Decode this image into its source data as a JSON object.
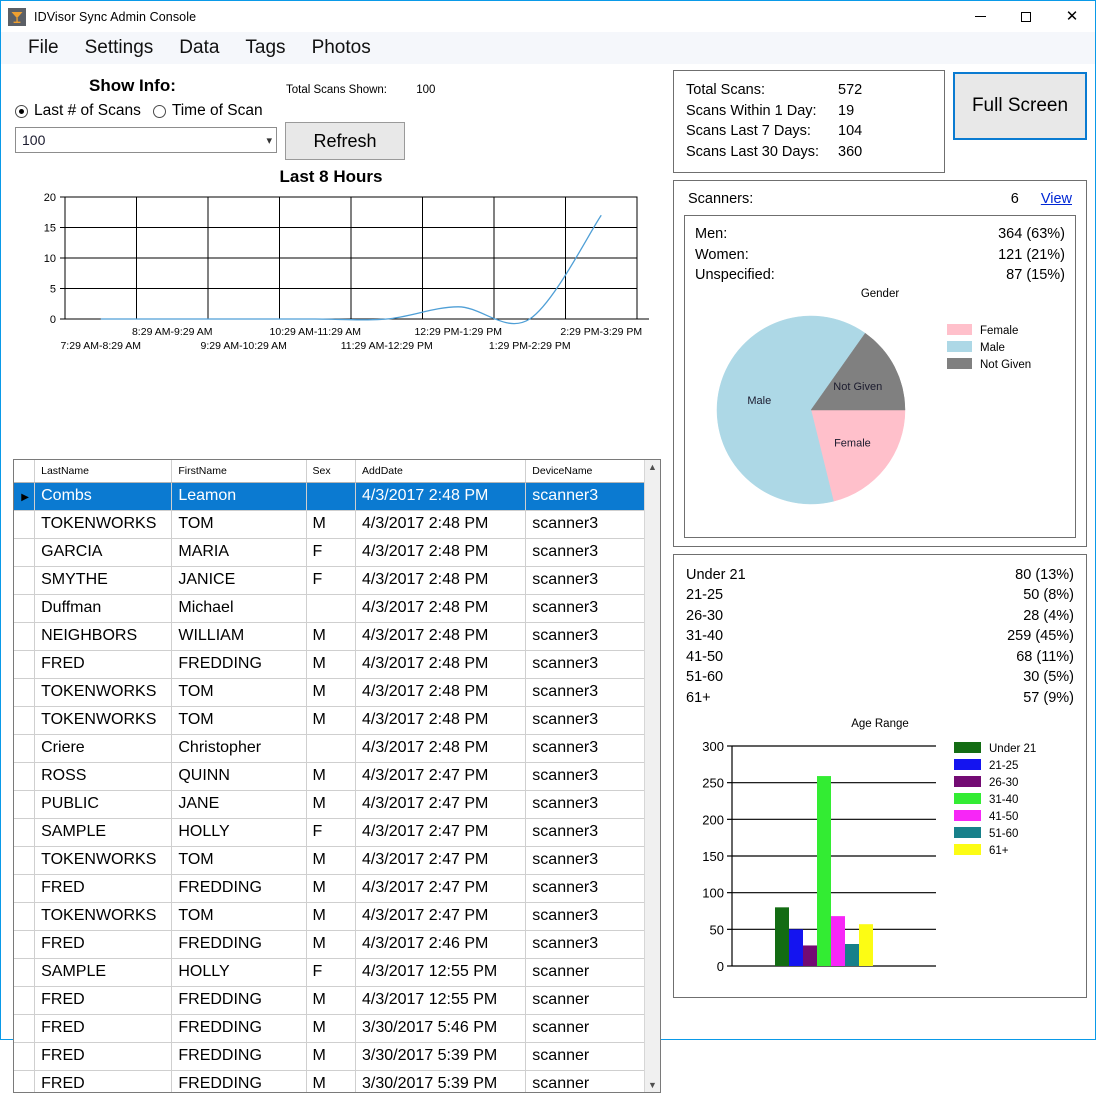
{
  "window": {
    "title": "IDVisor Sync Admin Console",
    "icon": "martini-glass-icon",
    "controls": {
      "minimize": "–",
      "maximize": "□",
      "close": "✕"
    }
  },
  "menu": {
    "items": [
      "File",
      "Settings",
      "Data",
      "Tags",
      "Photos"
    ]
  },
  "showinfo": {
    "title": "Show Info:",
    "total_scans_label": "Total Scans Shown:",
    "total_scans_value": "100",
    "radio_last_n": "Last # of Scans",
    "radio_time_of_scan": "Time of Scan",
    "selected_radio": "Last # of Scans",
    "combo_value": "100",
    "refresh_label": "Refresh"
  },
  "summary": {
    "rows": [
      {
        "label": "Total Scans:",
        "value": "572"
      },
      {
        "label": "Scans Within 1 Day:",
        "value": "19"
      },
      {
        "label": "Scans Last 7 Days:",
        "value": "104"
      },
      {
        "label": "Scans Last 30 Days:",
        "value": "360"
      }
    ],
    "fullscreen_label": "Full Screen"
  },
  "scanners": {
    "label": "Scanners:",
    "count": "6",
    "view_link": "View"
  },
  "gender": {
    "rows": [
      {
        "label": "Men:",
        "value": "364 (63%)"
      },
      {
        "label": "Women:",
        "value": "121 (21%)"
      },
      {
        "label": "Unspecified:",
        "value": "87 (15%)"
      }
    ]
  },
  "age": {
    "rows": [
      {
        "label": "Under 21",
        "value": "80 (13%)"
      },
      {
        "label": "21-25",
        "value": "50 (8%)"
      },
      {
        "label": "26-30",
        "value": "28 (4%)"
      },
      {
        "label": "31-40",
        "value": "259 (45%)"
      },
      {
        "label": "41-50",
        "value": "68 (11%)"
      },
      {
        "label": "51-60",
        "value": "30 (5%)"
      },
      {
        "label": "61+",
        "value": "57 (9%)"
      }
    ]
  },
  "grid": {
    "columns": [
      "",
      "LastName",
      "FirstName",
      "Sex",
      "AddDate",
      "DeviceName"
    ],
    "rows": [
      {
        "last": "Combs",
        "first": "Leamon",
        "sex": "",
        "date": "4/3/2017 2:48 PM",
        "device": "scanner3",
        "selected": true
      },
      {
        "last": "TOKENWORKS",
        "first": "TOM",
        "sex": "M",
        "date": "4/3/2017 2:48 PM",
        "device": "scanner3"
      },
      {
        "last": "GARCIA",
        "first": "MARIA",
        "sex": "F",
        "date": "4/3/2017 2:48 PM",
        "device": "scanner3"
      },
      {
        "last": "SMYTHE",
        "first": "JANICE",
        "sex": "F",
        "date": "4/3/2017 2:48 PM",
        "device": "scanner3"
      },
      {
        "last": "Duffman",
        "first": "Michael",
        "sex": "",
        "date": "4/3/2017 2:48 PM",
        "device": "scanner3"
      },
      {
        "last": "NEIGHBORS",
        "first": "WILLIAM",
        "sex": "M",
        "date": "4/3/2017 2:48 PM",
        "device": "scanner3"
      },
      {
        "last": "FRED",
        "first": "FREDDING",
        "sex": "M",
        "date": "4/3/2017 2:48 PM",
        "device": "scanner3"
      },
      {
        "last": "TOKENWORKS",
        "first": "TOM",
        "sex": "M",
        "date": "4/3/2017 2:48 PM",
        "device": "scanner3"
      },
      {
        "last": "TOKENWORKS",
        "first": "TOM",
        "sex": "M",
        "date": "4/3/2017 2:48 PM",
        "device": "scanner3"
      },
      {
        "last": "Criere",
        "first": "Christopher",
        "sex": "",
        "date": "4/3/2017 2:48 PM",
        "device": "scanner3"
      },
      {
        "last": "ROSS",
        "first": "QUINN",
        "sex": "M",
        "date": "4/3/2017 2:47 PM",
        "device": "scanner3"
      },
      {
        "last": "PUBLIC",
        "first": "JANE",
        "sex": "M",
        "date": "4/3/2017 2:47 PM",
        "device": "scanner3"
      },
      {
        "last": "SAMPLE",
        "first": "HOLLY",
        "sex": "F",
        "date": "4/3/2017 2:47 PM",
        "device": "scanner3"
      },
      {
        "last": "TOKENWORKS",
        "first": "TOM",
        "sex": "M",
        "date": "4/3/2017 2:47 PM",
        "device": "scanner3"
      },
      {
        "last": "FRED",
        "first": "FREDDING",
        "sex": "M",
        "date": "4/3/2017 2:47 PM",
        "device": "scanner3"
      },
      {
        "last": "TOKENWORKS",
        "first": "TOM",
        "sex": "M",
        "date": "4/3/2017 2:47 PM",
        "device": "scanner3"
      },
      {
        "last": "FRED",
        "first": "FREDDING",
        "sex": "M",
        "date": "4/3/2017 2:46 PM",
        "device": "scanner3"
      },
      {
        "last": "SAMPLE",
        "first": "HOLLY",
        "sex": "F",
        "date": "4/3/2017 12:55 PM",
        "device": "scanner"
      },
      {
        "last": "FRED",
        "first": "FREDDING",
        "sex": "M",
        "date": "4/3/2017 12:55 PM",
        "device": "scanner"
      },
      {
        "last": "FRED",
        "first": "FREDDING",
        "sex": "M",
        "date": "3/30/2017 5:46 PM",
        "device": "scanner"
      },
      {
        "last": "FRED",
        "first": "FREDDING",
        "sex": "M",
        "date": "3/30/2017 5:39 PM",
        "device": "scanner"
      },
      {
        "last": "FRED",
        "first": "FREDDING",
        "sex": "M",
        "date": "3/30/2017 5:39 PM",
        "device": "scanner"
      }
    ]
  },
  "chart_data": [
    {
      "type": "line",
      "title": "Last 8 Hours",
      "xlabel": "",
      "ylabel": "",
      "ylim": [
        0,
        20
      ],
      "yticks": [
        0,
        5,
        10,
        15,
        20
      ],
      "grid": true,
      "line_color": "#4f9fd6",
      "categories": [
        "7:29 AM-8:29 AM",
        "8:29 AM-9:29 AM",
        "9:29 AM-10:29 AM",
        "10:29 AM-11:29 AM",
        "11:29 AM-12:29 PM",
        "12:29 PM-1:29 PM",
        "1:29 PM-2:29 PM",
        "2:29 PM-3:29 PM"
      ],
      "values": [
        0,
        0,
        0,
        0,
        0,
        2,
        0,
        17
      ]
    },
    {
      "type": "pie",
      "title": "Gender",
      "legend_position": "right",
      "labels": [
        "Female",
        "Male",
        "Not Given"
      ],
      "values": [
        121,
        364,
        87
      ],
      "percents": [
        21,
        63,
        15
      ],
      "colors": [
        "#ffc0cb",
        "#add8e6",
        "#808080"
      ],
      "slice_labels": [
        "Female",
        "Male",
        "Not Given"
      ]
    },
    {
      "type": "bar",
      "title": "Age Range",
      "xlabel": "",
      "ylabel": "",
      "ylim": [
        0,
        300
      ],
      "yticks": [
        0,
        50,
        100,
        150,
        200,
        250,
        300
      ],
      "grid": true,
      "legend_position": "right",
      "categories": [
        "Under 21",
        "21-25",
        "26-30",
        "31-40",
        "41-50",
        "51-60",
        "61+"
      ],
      "values": [
        80,
        50,
        28,
        259,
        68,
        30,
        57
      ],
      "colors": [
        "#136c13",
        "#1414f0",
        "#730b73",
        "#33ec33",
        "#f726f7",
        "#17808a",
        "#fcfc14"
      ]
    }
  ]
}
